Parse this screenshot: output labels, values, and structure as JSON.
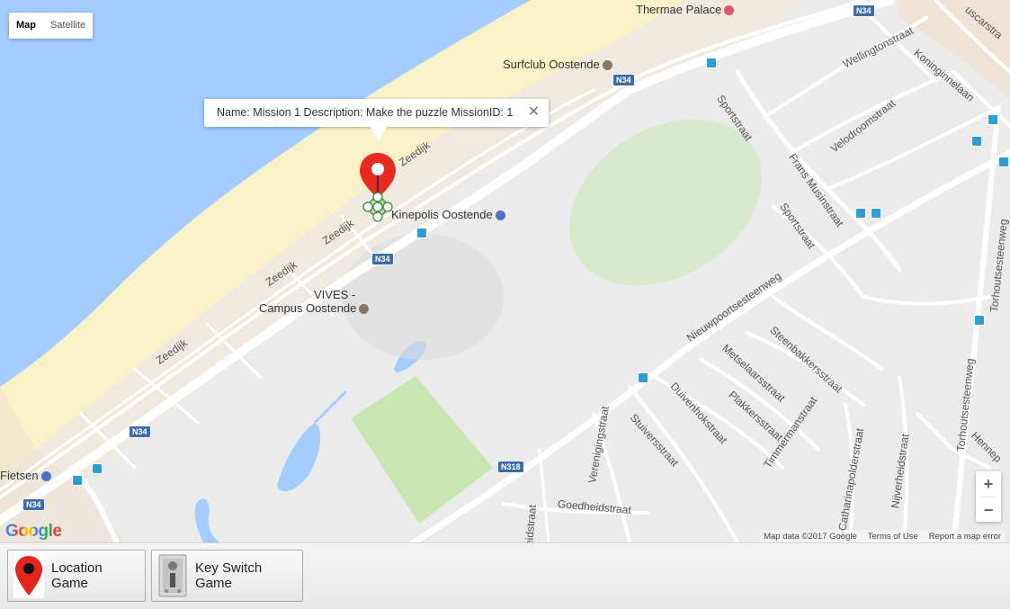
{
  "map_type": {
    "map_label": "Map",
    "satellite_label": "Satellite",
    "selected": "Map"
  },
  "info_window": {
    "text": "Name: Mission 1 Description: Make the puzzle MissionID: 1",
    "close_symbol": "✕"
  },
  "labels": {
    "thermae_palace": "Thermae Palace",
    "surfclub": "Surfclub Oostende",
    "kinepolis": "Kinepolis Oostende",
    "vives_line1": "VIVES -",
    "vives_line2": "Campus Oostende",
    "fietsen": "Fietsen",
    "zeedijk_1": "Zeedijk",
    "zeedijk_2": "Zeedijk",
    "zeedijk_3": "Zeedijk",
    "zeedijk_4": "Zeedijk",
    "wellingtonstraat": "Wellingtonstraat",
    "koninginnelaan": "Koninginnelaan",
    "sportstraat_1": "Sportstraat",
    "sportstraat_2": "Sportstraat",
    "frans_musinstraat": "Frans Musinstraat",
    "velodroomstraat": "Velodroomstraat",
    "nieuwpoortsesteenweg": "Nieuwpoortsesteenweg",
    "steenbakkersstraat": "Steenbakkersstraat",
    "metselaarsstraat": "Metselaarsstraat",
    "plakkersstraat": "Plakkersstraat",
    "duivenhokstraat": "Duivenhokstraat",
    "stuiversstraat": "Stuiversstraat",
    "verenigingstraat": "Verenigingstraat",
    "goedheidstraat": "Goedheidstraat",
    "timmermanstraat": "Timmermanstraat",
    "catharinapolderstraat": "t-Catharinapolderstraat",
    "nijverheidstraat": "Nijverheidstraat",
    "torhoutsesteenweg_1": "Torhoutsesteenweg",
    "torhoutsesteenweg_2": "Torhoutsesteenweg",
    "hennepstraat": "Hennep",
    "euscarstraat": "uscarstra",
    "heidstraat": "eidstraat"
  },
  "road_shields": {
    "n34_a": "N34",
    "n34_b": "N34",
    "n34_c": "N34",
    "n34_d": "N34",
    "n34_e": "N34",
    "n318": "N318"
  },
  "zoom": {
    "in": "+",
    "out": "−"
  },
  "attribution": {
    "data": "Map data ©2017 Google",
    "terms": "Terms of Use",
    "report": "Report a map error"
  },
  "google_logo": "Google",
  "colors": {
    "water": "#a3ccff",
    "beach": "#faf2c7",
    "land": "#e8e8e8",
    "park": "#c8e6b2",
    "road": "#ffffff",
    "marker": "#ea2a1f",
    "shield": "#3b6ea8"
  },
  "toolbar": {
    "buttons": [
      {
        "label": "Location Game",
        "icon": "map-pin-icon"
      },
      {
        "label": "Key Switch Game",
        "icon": "key-switch-icon"
      }
    ]
  }
}
